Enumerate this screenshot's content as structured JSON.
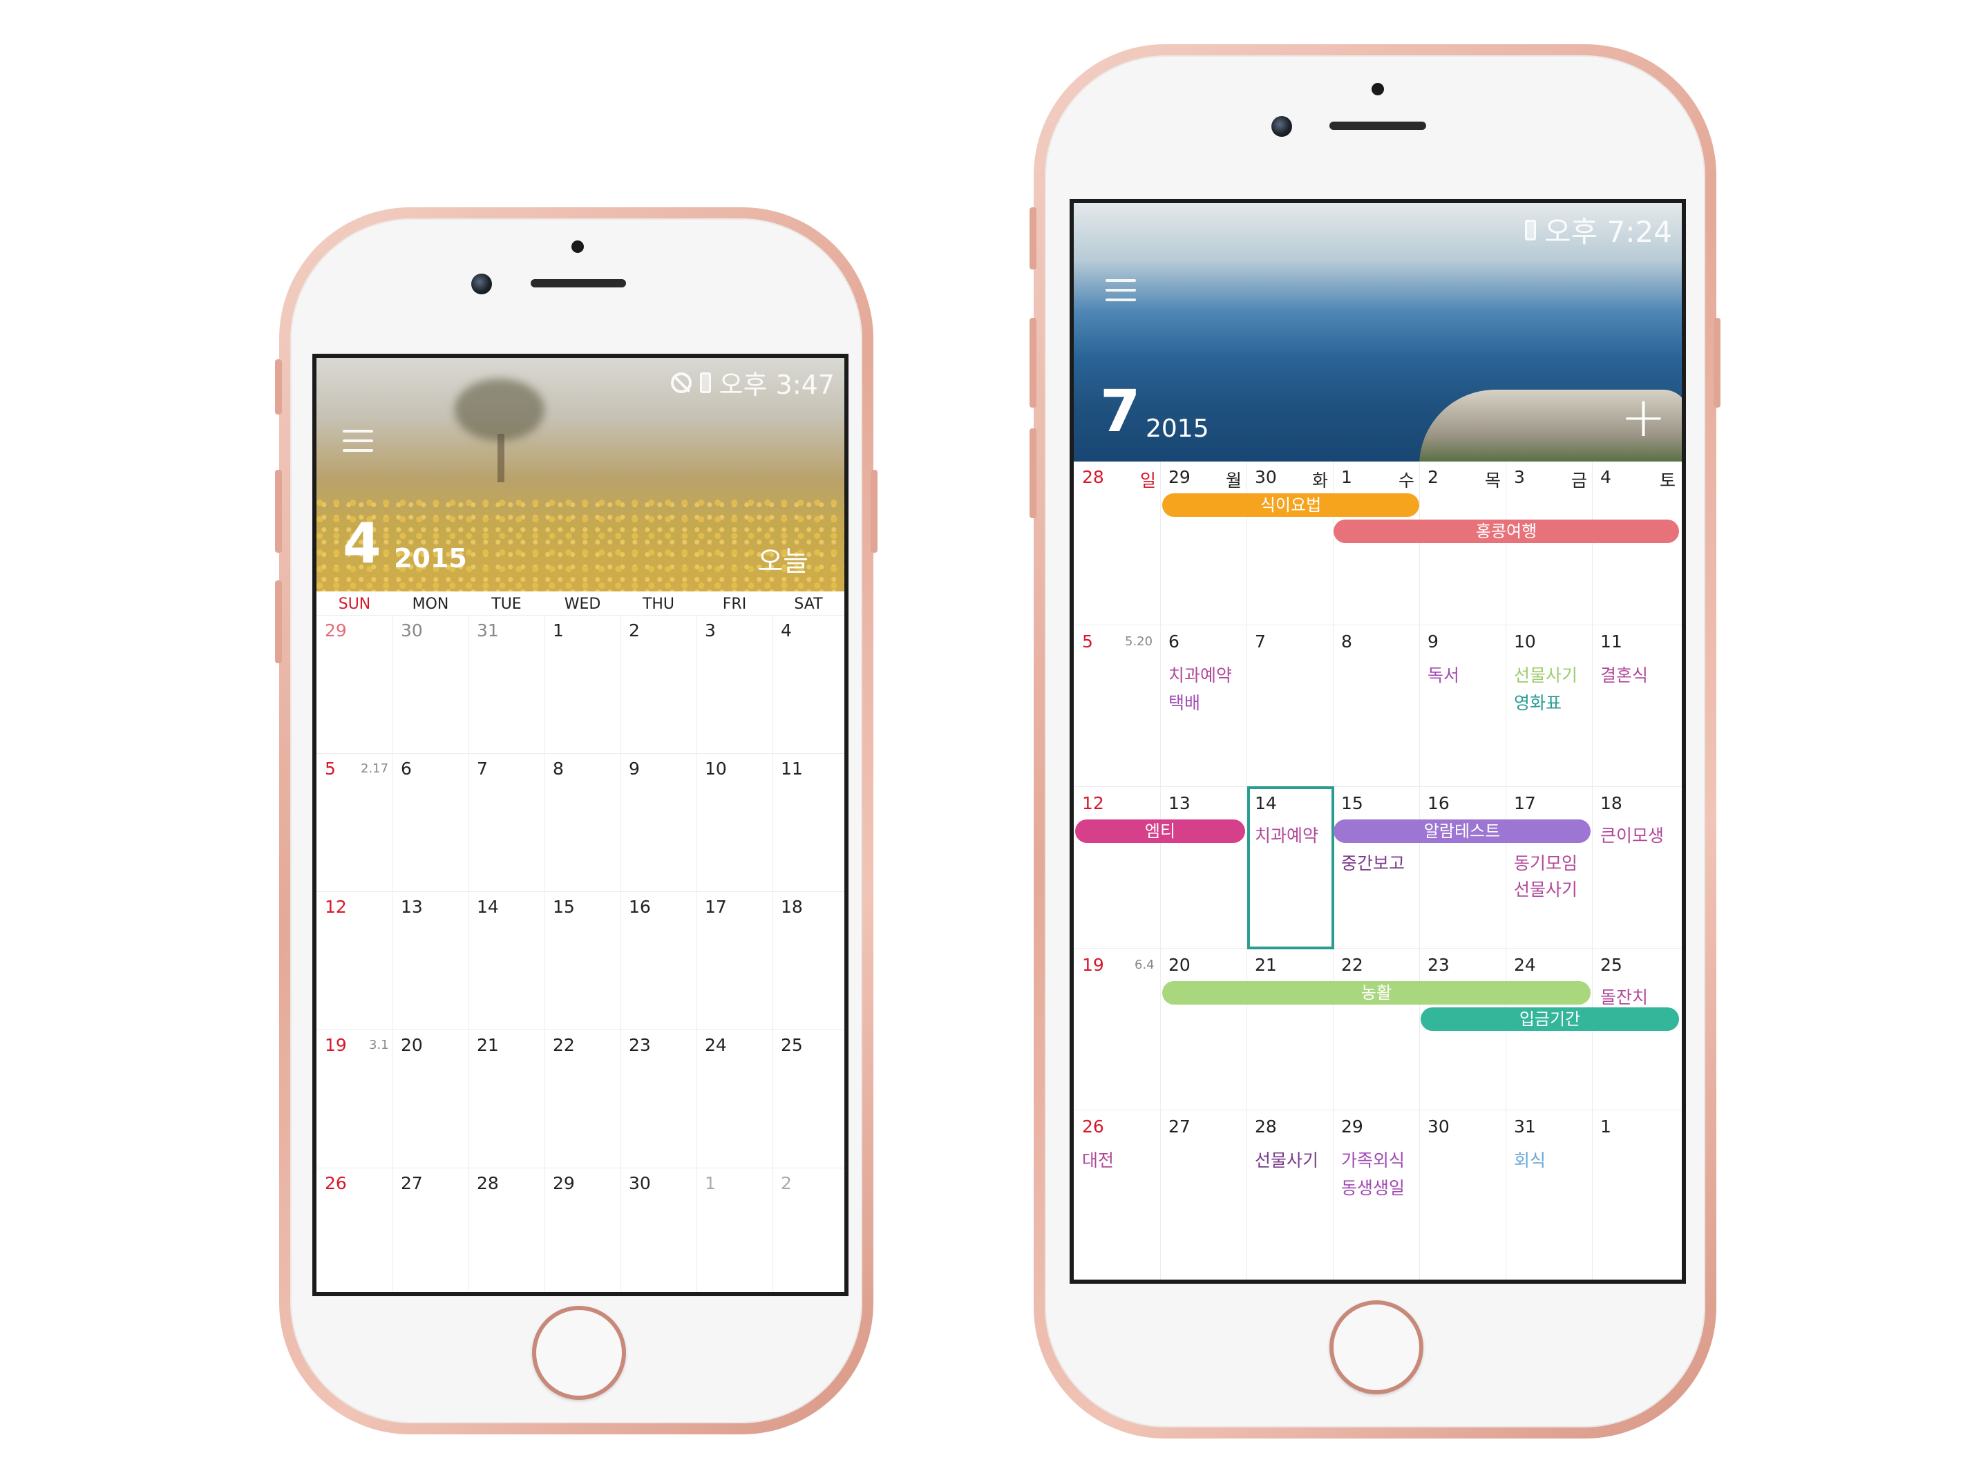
{
  "phone_left": {
    "status_time": "오후 3:47",
    "month": "4",
    "year": "2015",
    "today_label": "오늘",
    "weekdays": [
      "SUN",
      "MON",
      "TUE",
      "WED",
      "THU",
      "FRI",
      "SAT"
    ],
    "weeks": [
      {
        "days": [
          "29",
          "30",
          "31",
          "1",
          "2",
          "3",
          "4"
        ],
        "lunar": ""
      },
      {
        "days": [
          "5",
          "6",
          "7",
          "8",
          "9",
          "10",
          "11"
        ],
        "lunar": "2.17"
      },
      {
        "days": [
          "12",
          "13",
          "14",
          "15",
          "16",
          "17",
          "18"
        ],
        "lunar": ""
      },
      {
        "days": [
          "19",
          "20",
          "21",
          "22",
          "23",
          "24",
          "25"
        ],
        "lunar": "3.1"
      },
      {
        "days": [
          "26",
          "27",
          "28",
          "29",
          "30",
          "1",
          "2"
        ],
        "lunar": ""
      }
    ]
  },
  "phone_right": {
    "status_time": "오후 7:24",
    "month": "7",
    "year": "2015",
    "add_label": "+",
    "week1": {
      "sun": "28",
      "items": [
        {
          "wd": "일",
          "d": "29"
        },
        {
          "wd": "월",
          "d": "30"
        },
        {
          "wd": "화",
          "d": "1"
        },
        {
          "wd": "수",
          "d": "2"
        },
        {
          "wd": "목",
          "d": "3"
        },
        {
          "wd": "금",
          "d": "4"
        },
        {
          "wd": "토",
          "d": ""
        }
      ]
    },
    "weeks": [
      {
        "days": [
          "5",
          "6",
          "7",
          "8",
          "9",
          "10",
          "11"
        ],
        "lunar": "5.20"
      },
      {
        "days": [
          "12",
          "13",
          "14",
          "15",
          "16",
          "17",
          "18"
        ],
        "lunar": ""
      },
      {
        "days": [
          "19",
          "20",
          "21",
          "22",
          "23",
          "24",
          "25"
        ],
        "lunar": "6.4"
      },
      {
        "days": [
          "26",
          "27",
          "28",
          "29",
          "30",
          "31",
          "1"
        ],
        "lunar": ""
      }
    ],
    "events": {
      "diet": "식이요법",
      "hongkong": "홍콩여행",
      "w2_dentist": "치과예약",
      "w2_delivery": "택배",
      "w2_reading": "독서",
      "w2_gift": "선물사기",
      "w2_movie": "영화표",
      "w2_wedding": "결혼식",
      "w3_mt": "엠티",
      "w3_dentist": "치과예약",
      "w3_alarm": "알람테스트",
      "w3_midterm": "중간보고",
      "w3_club": "동기모임",
      "w3_gift": "선물사기",
      "w3_aunt": "큰이모생",
      "w4_farm": "농활",
      "w4_dol": "돌잔치",
      "w4_deposit": "입금기간",
      "w5_match": "대전",
      "w5_gift": "선물사기",
      "w5_family": "가족외식",
      "w5_sibling": "동생생일",
      "w5_party": "회식"
    },
    "colors": {
      "diet": "#f6a31e",
      "hongkong": "#e8727a",
      "mt": "#d6408a",
      "alarm": "#9c76d2",
      "farm": "#a9d77e",
      "deposit": "#34b69a",
      "today_outline": "#2a9c92"
    }
  }
}
